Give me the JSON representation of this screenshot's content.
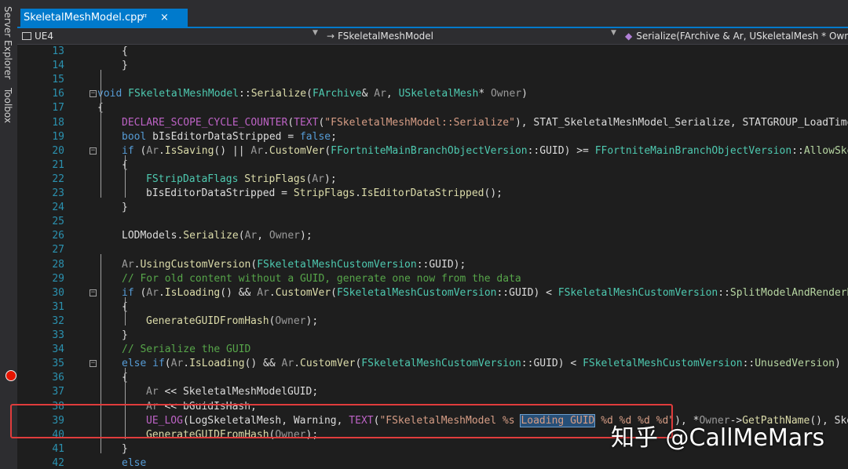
{
  "side_tabs": {
    "server_explorer": "Server Explorer",
    "toolbox": "Toolbox"
  },
  "tab": {
    "title": "SkeletalMeshModel.cpp",
    "pin": "ꟸ",
    "close": "×"
  },
  "nav": {
    "project": "UE4",
    "class": "FSkeletalMeshModel",
    "member": "Serialize(FArchive & Ar, USkeletalMesh * Owner)"
  },
  "watermark": "知乎 @CallMeMars",
  "code": {
    "lines": [
      {
        "n": "13",
        "indent": 1,
        "tokens": [
          [
            "o",
            "{"
          ]
        ]
      },
      {
        "n": "14",
        "indent": 1,
        "tokens": [
          [
            "o",
            "}"
          ]
        ]
      },
      {
        "n": "15",
        "indent": 0,
        "tokens": []
      },
      {
        "n": "16",
        "indent": 0,
        "fold": "−",
        "tokens": [
          [
            "k",
            "void "
          ],
          [
            "t",
            "FSkeletalMeshModel"
          ],
          [
            "o",
            "::"
          ],
          [
            "f",
            "Serialize"
          ],
          [
            "o",
            "("
          ],
          [
            "t",
            "FArchive"
          ],
          [
            "o",
            "& "
          ],
          [
            "p",
            "Ar"
          ],
          [
            "o",
            ", "
          ],
          [
            "t",
            "USkeletalMesh"
          ],
          [
            "o",
            "* "
          ],
          [
            "p",
            "Owner"
          ],
          [
            "o",
            ")"
          ]
        ]
      },
      {
        "n": "17",
        "indent": 0,
        "tokens": [
          [
            "o",
            "{"
          ]
        ]
      },
      {
        "n": "18",
        "indent": 1,
        "tokens": [
          [
            "m",
            "DECLARE_SCOPE_CYCLE_COUNTER"
          ],
          [
            "o",
            "("
          ],
          [
            "m",
            "TEXT"
          ],
          [
            "o",
            "("
          ],
          [
            "s",
            "\"FSkeletalMeshModel::Serialize\""
          ],
          [
            "o",
            "), STAT_SkeletalMeshModel_Serialize, STATGROUP_LoadTime);"
          ]
        ]
      },
      {
        "n": "19",
        "indent": 1,
        "tokens": [
          [
            "k",
            "bool "
          ],
          [
            "o",
            "bIsEditorDataStripped = "
          ],
          [
            "k",
            "false"
          ],
          [
            "o",
            ";"
          ]
        ]
      },
      {
        "n": "20",
        "indent": 1,
        "fold": "−",
        "tokens": [
          [
            "k",
            "if "
          ],
          [
            "o",
            "("
          ],
          [
            "p",
            "Ar"
          ],
          [
            "o",
            "."
          ],
          [
            "f",
            "IsSaving"
          ],
          [
            "o",
            "() || "
          ],
          [
            "p",
            "Ar"
          ],
          [
            "o",
            "."
          ],
          [
            "f",
            "CustomVer"
          ],
          [
            "o",
            "("
          ],
          [
            "t",
            "FFortniteMainBranchObjectVersion"
          ],
          [
            "o",
            "::GUID) >= "
          ],
          [
            "t",
            "FFortniteMainBranchObjectVersion"
          ],
          [
            "o",
            "::"
          ],
          [
            "e",
            "AllowSkeletalMeshToReduceTheBaseLOD"
          ]
        ]
      },
      {
        "n": "21",
        "indent": 1,
        "tokens": [
          [
            "o",
            "{"
          ]
        ]
      },
      {
        "n": "22",
        "indent": 2,
        "tokens": [
          [
            "t",
            "FStripDataFlags "
          ],
          [
            "f",
            "StripFlags"
          ],
          [
            "o",
            "("
          ],
          [
            "p",
            "Ar"
          ],
          [
            "o",
            ");"
          ]
        ]
      },
      {
        "n": "23",
        "indent": 2,
        "tokens": [
          [
            "o",
            "bIsEditorDataStripped = "
          ],
          [
            "f",
            "StripFlags"
          ],
          [
            "o",
            "."
          ],
          [
            "f",
            "IsEditorDataStripped"
          ],
          [
            "o",
            "();"
          ]
        ]
      },
      {
        "n": "24",
        "indent": 1,
        "tokens": [
          [
            "o",
            "}"
          ]
        ]
      },
      {
        "n": "25",
        "indent": 0,
        "tokens": []
      },
      {
        "n": "26",
        "indent": 1,
        "tokens": [
          [
            "o",
            "LODModels."
          ],
          [
            "f",
            "Serialize"
          ],
          [
            "o",
            "("
          ],
          [
            "p",
            "Ar"
          ],
          [
            "o",
            ", "
          ],
          [
            "p",
            "Owner"
          ],
          [
            "o",
            ");"
          ]
        ]
      },
      {
        "n": "27",
        "indent": 0,
        "tokens": []
      },
      {
        "n": "28",
        "indent": 1,
        "tokens": [
          [
            "p",
            "Ar"
          ],
          [
            "o",
            "."
          ],
          [
            "f",
            "UsingCustomVersion"
          ],
          [
            "o",
            "("
          ],
          [
            "t",
            "FSkeletalMeshCustomVersion"
          ],
          [
            "o",
            "::GUID);"
          ]
        ]
      },
      {
        "n": "29",
        "indent": 1,
        "tokens": [
          [
            "c",
            "// For old content without a GUID, generate one now from the data"
          ]
        ]
      },
      {
        "n": "30",
        "indent": 1,
        "fold": "−",
        "tokens": [
          [
            "k",
            "if "
          ],
          [
            "o",
            "("
          ],
          [
            "p",
            "Ar"
          ],
          [
            "o",
            "."
          ],
          [
            "f",
            "IsLoading"
          ],
          [
            "o",
            "() && "
          ],
          [
            "p",
            "Ar"
          ],
          [
            "o",
            "."
          ],
          [
            "f",
            "CustomVer"
          ],
          [
            "o",
            "("
          ],
          [
            "t",
            "FSkeletalMeshCustomVersion"
          ],
          [
            "o",
            "::GUID) < "
          ],
          [
            "t",
            "FSkeletalMeshCustomVersion"
          ],
          [
            "o",
            "::"
          ],
          [
            "e",
            "SplitModelAndRenderData"
          ]
        ]
      },
      {
        "n": "31",
        "indent": 1,
        "tokens": [
          [
            "o",
            "{"
          ]
        ]
      },
      {
        "n": "32",
        "indent": 2,
        "tokens": [
          [
            "f",
            "GenerateGUIDFromHash"
          ],
          [
            "o",
            "("
          ],
          [
            "p",
            "Owner"
          ],
          [
            "o",
            ");"
          ]
        ]
      },
      {
        "n": "33",
        "indent": 1,
        "tokens": [
          [
            "o",
            "}"
          ]
        ]
      },
      {
        "n": "34",
        "indent": 1,
        "tokens": [
          [
            "c",
            "// Serialize the GUID"
          ]
        ]
      },
      {
        "n": "35",
        "indent": 1,
        "fold": "−",
        "tokens": [
          [
            "k",
            "else if"
          ],
          [
            "o",
            "("
          ],
          [
            "p",
            "Ar"
          ],
          [
            "o",
            "."
          ],
          [
            "f",
            "IsLoading"
          ],
          [
            "o",
            "() && "
          ],
          [
            "p",
            "Ar"
          ],
          [
            "o",
            "."
          ],
          [
            "f",
            "CustomVer"
          ],
          [
            "o",
            "("
          ],
          [
            "t",
            "FSkeletalMeshCustomVersion"
          ],
          [
            "o",
            "::GUID) < "
          ],
          [
            "t",
            "FSkeletalMeshCustomVersion"
          ],
          [
            "o",
            "::"
          ],
          [
            "e",
            "UnusedVersion"
          ],
          [
            "o",
            ")"
          ]
        ]
      },
      {
        "n": "36",
        "indent": 1,
        "tokens": [
          [
            "o",
            "{"
          ]
        ]
      },
      {
        "n": "37",
        "indent": 2,
        "tokens": [
          [
            "p",
            "Ar "
          ],
          [
            "o",
            "<< SkeletalMeshModelGUID;"
          ]
        ]
      },
      {
        "n": "38",
        "indent": 2,
        "tokens": [
          [
            "p",
            "Ar "
          ],
          [
            "o",
            "<< bGuidIsHash;"
          ]
        ]
      },
      {
        "n": "39",
        "indent": 2,
        "tokens": [
          [
            "m",
            "UE_LOG"
          ],
          [
            "o",
            "(LogSkeletalMesh, Warning, "
          ],
          [
            "m",
            "TEXT"
          ],
          [
            "o",
            "("
          ],
          [
            "s",
            "\"FSkeletalMeshModel %s "
          ],
          [
            "s hl",
            "Loading GUID"
          ],
          [
            "s",
            " %d %d %d %d\""
          ],
          [
            "o",
            "), *"
          ],
          [
            "p",
            "Owner"
          ],
          [
            "o",
            "->"
          ],
          [
            "f",
            "GetPathName"
          ],
          [
            "o",
            "(), SkeletalMeshModelGUID.A"
          ]
        ]
      },
      {
        "n": "40",
        "indent": 2,
        "tokens": [
          [
            "f",
            "GenerateGUIDFromHash"
          ],
          [
            "o",
            "("
          ],
          [
            "p",
            "Owner"
          ],
          [
            "o",
            ");"
          ]
        ]
      },
      {
        "n": "41",
        "indent": 1,
        "tokens": [
          [
            "o",
            "}"
          ]
        ]
      },
      {
        "n": "42",
        "indent": 1,
        "tokens": [
          [
            "k",
            "else"
          ]
        ]
      }
    ]
  }
}
